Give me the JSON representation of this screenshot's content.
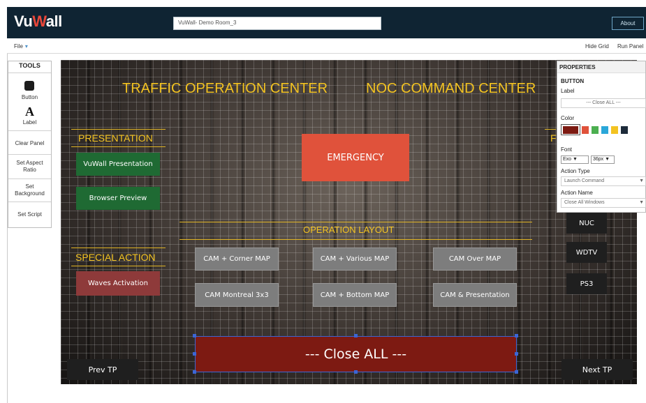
{
  "app": {
    "logo_a": "Vu",
    "logo_b": "W",
    "logo_c": "all",
    "room_name": "VuWall- Demo Room_3",
    "about_label": "About"
  },
  "menu": {
    "file": "File",
    "file_caret": "▾",
    "hide_grid": "Hide Grid",
    "run_panel": "Run Panel"
  },
  "tools": {
    "title": "TOOLS",
    "button_label": "Button",
    "label_glyph": "A",
    "label_label": "Label",
    "clear_panel": "Clear Panel",
    "set_aspect_ratio_1": "Set Aspect",
    "set_aspect_ratio_2": "Ratio",
    "set_background_1": "Set",
    "set_background_2": "Background",
    "set_script": "Set Script"
  },
  "canvas": {
    "title_left": "TRAFFIC OPERATION CENTER",
    "title_right": "NOC COMMAND CENTER",
    "section_presentation": "PRESENTATION",
    "section_special": "SPECIAL ACTION",
    "section_operation": "OPERATION LAYOUT",
    "section_f": "F",
    "buttons": {
      "vuwall_presentation": "VuWall Presentation",
      "browser_preview": "Browser Preview",
      "waves_activation": "Waves Activation",
      "emergency": "EMERGENCY",
      "cam_corner_map": "CAM + Corner MAP",
      "cam_various_map": "CAM + Various MAP",
      "cam_over_map": "CAM Over MAP",
      "cam_montreal": "CAM Montreal 3x3",
      "cam_bottom_map": "CAM + Bottom MAP",
      "cam_presentation": "CAM & Presentation",
      "nuc": "NUC",
      "wdtv": "WDTV",
      "ps3": "PS3",
      "close_all": "--- Close ALL ---",
      "prev_tp": "Prev TP",
      "next_tp": "Next TP"
    }
  },
  "properties": {
    "title": "PROPERTIES",
    "section": "BUTTON",
    "label_heading": "Label",
    "label_value": "--- Close ALL ---",
    "color_heading": "Color",
    "swatches": [
      "#7d1a12",
      "#e0523b",
      "#4caf50",
      "#2aa7d9",
      "#f3c321",
      "#1d2b3a"
    ],
    "font_heading": "Font",
    "font_family": "Exo",
    "font_size": "36px",
    "action_type_heading": "Action Type",
    "action_type_value": "Launch Command",
    "action_name_heading": "Action Name",
    "action_name_value": "Close All Windows",
    "select_caret": "▼"
  },
  "colors": {
    "topbar": "#0f2433",
    "accent_yellow": "#f3c321",
    "emergency": "#e0523b",
    "close_all": "#7d1a12",
    "green_button": "#1f6a33",
    "grey_button": "#7d7d7d"
  }
}
